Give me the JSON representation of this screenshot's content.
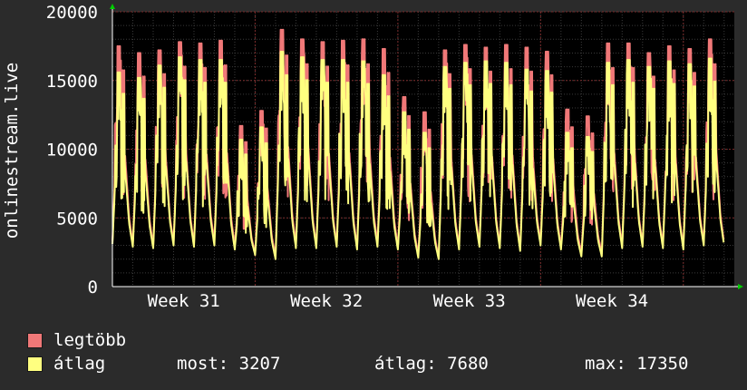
{
  "chart_data": {
    "type": "line",
    "ylabel": "onlinestream.live",
    "ylim": [
      0,
      20000
    ],
    "yticks": [
      0,
      5000,
      10000,
      15000,
      20000
    ],
    "ytick_labels": [
      "0",
      "5000",
      "10000",
      "15000",
      "20000"
    ],
    "x_range_days": [
      0,
      30.5
    ],
    "xticks": [
      {
        "label": "Week 31",
        "day": 3.5
      },
      {
        "label": "Week 32",
        "day": 10.5
      },
      {
        "label": "Week 33",
        "day": 17.5
      },
      {
        "label": "Week 34",
        "day": 24.5
      }
    ],
    "series": [
      {
        "name": "legtöbb",
        "color": "#f07878",
        "daily_peaks": [
          17500,
          17000,
          17200,
          17800,
          17700,
          17900,
          11700,
          12800,
          18700,
          18000,
          17800,
          17900,
          18000,
          17300,
          13800,
          12700,
          17200,
          17600,
          17400,
          17600,
          17400,
          17100,
          12900,
          12400,
          17700,
          17700,
          17000,
          17500,
          17300,
          18000
        ],
        "daily_lows": [
          3300,
          3100,
          3000,
          3200,
          3100,
          3300,
          3000,
          2400,
          2200,
          3100,
          3000,
          3100,
          2900,
          3200,
          2900,
          2300,
          2100,
          2900,
          3100,
          3000,
          2800,
          3200,
          2900,
          2400,
          2400,
          3000,
          3100,
          3000,
          2900,
          3200
        ]
      },
      {
        "name": "átlag",
        "color": "#ffff80",
        "daily_peaks": [
          15600,
          15200,
          16100,
          16700,
          16500,
          16500,
          10700,
          11600,
          17100,
          16700,
          16500,
          16500,
          16400,
          15400,
          12700,
          11200,
          16000,
          16300,
          16400,
          16300,
          15800,
          15700,
          11200,
          10900,
          16300,
          16500,
          16000,
          16400,
          16200,
          16600
        ],
        "daily_lows": [
          3100,
          2900,
          2800,
          3000,
          2900,
          3000,
          2700,
          2300,
          2000,
          2800,
          2800,
          2900,
          2700,
          2900,
          2700,
          2100,
          2000,
          2700,
          2900,
          2800,
          2600,
          3000,
          2700,
          2200,
          2200,
          2800,
          2900,
          2800,
          2700,
          3000
        ],
        "current": 3207
      }
    ],
    "grid": true
  },
  "legend": {
    "items": [
      {
        "label": "legtöbb",
        "color": "#f07878"
      },
      {
        "label": "átlag",
        "color": "#ffff80"
      }
    ],
    "stats": {
      "now": "most: 3207",
      "avg": "átlag: 7680",
      "max": "max: 17350"
    }
  },
  "colors": {
    "background": "#2b2b2b",
    "plot_background": "#000000",
    "grid_minor": "#3a3a3a",
    "grid_major": "#7a2a2a",
    "axis_arrow": "#00cc00"
  }
}
